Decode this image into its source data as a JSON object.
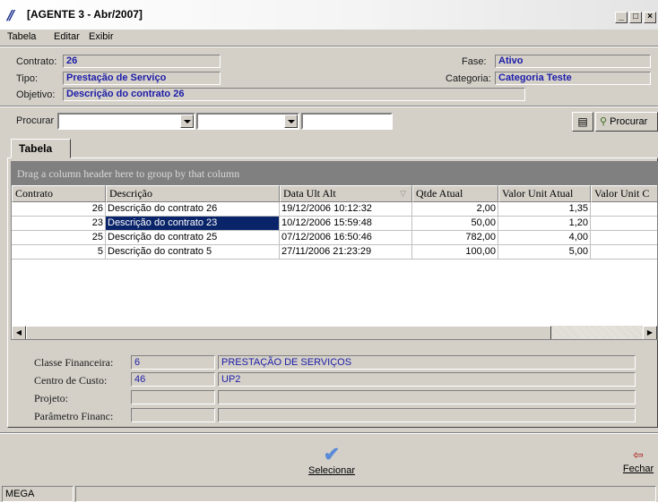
{
  "window": {
    "title": "[AGENTE 3 - Abr/2007]",
    "controls": [
      "_",
      "□",
      "×"
    ]
  },
  "menu": [
    "Tabela",
    "Editar",
    "Exibir"
  ],
  "header": {
    "contrato_label": "Contrato:",
    "contrato_value": "26",
    "tipo_label": "Tipo:",
    "tipo_value": "Prestação de Serviço",
    "objetivo_label": "Objetivo:",
    "objetivo_value": "Descrição do contrato 26",
    "fase_label": "Fase:",
    "fase_value": "Ativo",
    "categoria_label": "Categoria:",
    "categoria_value": "Categoria Teste"
  },
  "search": {
    "label": "Procurar",
    "button_label": "Procurar"
  },
  "tab": {
    "label": "Tabela"
  },
  "grid": {
    "group_hint": "Drag a column header here to group by that column",
    "columns": [
      "Contrato",
      "Descrição",
      "Data Ult Alt",
      "Qtde Atual",
      "Valor Unit Atual",
      "Valor Unit C"
    ],
    "sort_indicator": "▽",
    "rows": [
      {
        "contrato": "26",
        "descricao": "Descrição do contrato 26",
        "data": "19/12/2006 10:12:32",
        "qtde": "2,00",
        "valor": "1,35"
      },
      {
        "contrato": "23",
        "descricao": "Descrição do contrato 23",
        "data": "10/12/2006 15:59:48",
        "qtde": "50,00",
        "valor": "1,20"
      },
      {
        "contrato": "25",
        "descricao": "Descrição do contrato 25",
        "data": "07/12/2006 16:50:46",
        "qtde": "782,00",
        "valor": "4,00"
      },
      {
        "contrato": "5",
        "descricao": "Descrição do contrato 5",
        "data": "27/11/2006 21:23:29",
        "qtde": "100,00",
        "valor": "5,00"
      }
    ],
    "selected_row": 1
  },
  "details": {
    "classe_label": "Classe Financeira:",
    "classe_code": "6",
    "classe_name": "PRESTAÇÃO DE SERVIÇOS",
    "centro_label": "Centro de Custo:",
    "centro_code": "46",
    "centro_name": "UP2",
    "projeto_label": "Projeto:",
    "parametro_label": "Parâmetro Financ:"
  },
  "buttons": {
    "selecionar": "Selecionar",
    "fechar": "Fechar"
  },
  "status": {
    "text": "MEGA"
  },
  "colors": {
    "selection": "#0a246a",
    "value_text": "#1c1ca8",
    "face": "#d4d0c8"
  }
}
